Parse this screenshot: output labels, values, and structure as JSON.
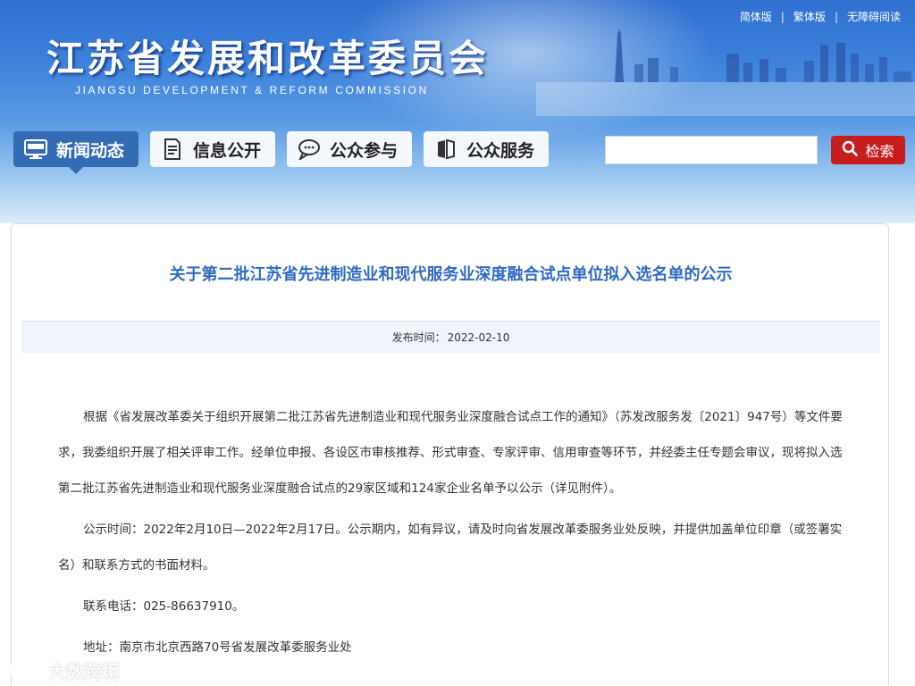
{
  "header": {
    "title": "江苏省发展和改革委员会",
    "subtitle": "JIANGSU DEVELOPMENT & REFORM COMMISSION",
    "lang_links": [
      "简体版",
      "繁体版",
      "无障碍阅读"
    ],
    "separator": "|"
  },
  "nav": {
    "items": [
      {
        "label": "新闻动态",
        "icon": "news-icon",
        "active": true
      },
      {
        "label": "信息公开",
        "icon": "document-icon",
        "active": false
      },
      {
        "label": "公众参与",
        "icon": "chat-icon",
        "active": false
      },
      {
        "label": "公众服务",
        "icon": "book-icon",
        "active": false
      }
    ]
  },
  "search": {
    "value": "",
    "button_label": "检索"
  },
  "article": {
    "title": "关于第二批江苏省先进制造业和现代服务业深度融合试点单位拟入选名单的公示",
    "publish_label": "发布时间：",
    "publish_date": "2022-02-10",
    "paragraphs": [
      "根据《省发展改革委关于组织开展第二批江苏省先进制造业和现代服务业深度融合试点工作的通知》（苏发改服务发〔2021〕947号）等文件要求，我委组织开展了相关评审工作。经单位申报、各设区市审核推荐、形式审查、专家评审、信用审查等环节，并经委主任专题会审议，现将拟入选第二批江苏省先进制造业和现代服务业深度融合试点的29家区域和124家企业名单予以公示（详见附件）。",
      "公示时间：2022年2月10日—2022年2月17日。公示期内，如有异议，请及时向省发展改革委服务业处反映，并提供加盖单位印章（或签署实名）和联系方式的书面材料。",
      "联系电话：025-86637910。",
      "地址：南京市北京西路70号省发展改革委服务业处"
    ]
  },
  "watermark": {
    "text": "大数跨境"
  },
  "colors": {
    "nav_active": "#336bb5",
    "search_button": "#c71d1d",
    "title_blue": "#2f6bc2"
  }
}
